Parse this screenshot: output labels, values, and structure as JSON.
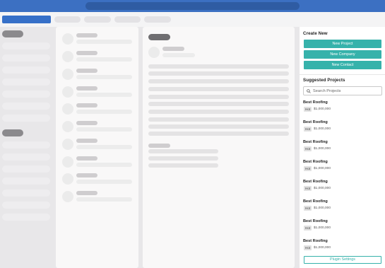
{
  "create_new": {
    "title": "Create New",
    "buttons": [
      "New Project",
      "New Company",
      "New Contact"
    ]
  },
  "suggested": {
    "title": "Suggested Projects",
    "search_placeholder": "Search Projects",
    "projects": [
      {
        "name": "Best Roofing",
        "badge": "Hot",
        "amount": "$1,000,000"
      },
      {
        "name": "Best Roofing",
        "badge": "Hot",
        "amount": "$1,000,000"
      },
      {
        "name": "Best Roofing",
        "badge": "Hot",
        "amount": "$1,000,000"
      },
      {
        "name": "Best Roofing",
        "badge": "Hot",
        "amount": "$1,000,000"
      },
      {
        "name": "Best Roofing",
        "badge": "Hot",
        "amount": "$1,000,000"
      },
      {
        "name": "Best Roofing",
        "badge": "Hot",
        "amount": "$1,000,000"
      },
      {
        "name": "Best Roofing",
        "badge": "Hot",
        "amount": "$1,000,000"
      },
      {
        "name": "Best Roofing",
        "badge": "Hot",
        "amount": "$1,000,000"
      }
    ]
  },
  "footer": {
    "plugin_settings_label": "Plugin Settings"
  },
  "colors": {
    "accent": "#36b2ab",
    "topbar": "#3c70c2",
    "active_tab": "#3670c8"
  },
  "icons": {
    "search": "search-icon"
  }
}
